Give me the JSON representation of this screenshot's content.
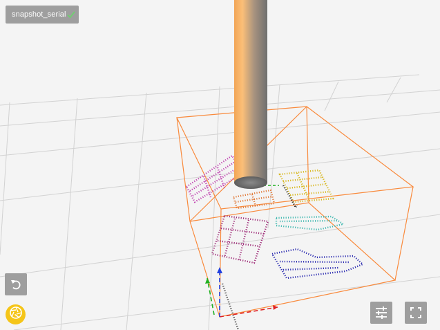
{
  "snapshot": {
    "name": "snapshot_serial",
    "status_icon": "check-icon"
  },
  "controls": {
    "reset_icon": "reset-view-icon",
    "capture_icon": "camera-shutter-icon",
    "settings_icon": "sliders-icon",
    "fullscreen_icon": "fullscreen-icon"
  },
  "scene": {
    "objects": [
      {
        "name": "cylinder",
        "color": "#f7a44a"
      },
      {
        "name": "bounding-box",
        "color": "#f98a3c"
      },
      {
        "name": "cloud-magenta",
        "color": "#c040b0"
      },
      {
        "name": "cloud-orange",
        "color": "#e07a3a"
      },
      {
        "name": "cloud-yellow",
        "color": "#d8b820"
      },
      {
        "name": "cloud-purple",
        "color": "#a0307a"
      },
      {
        "name": "cloud-teal",
        "color": "#40b8b0"
      },
      {
        "name": "cloud-blue",
        "color": "#2a2ab0"
      }
    ],
    "axes": {
      "x": "#e02020",
      "y": "#20b020",
      "z": "#2040e0"
    }
  }
}
